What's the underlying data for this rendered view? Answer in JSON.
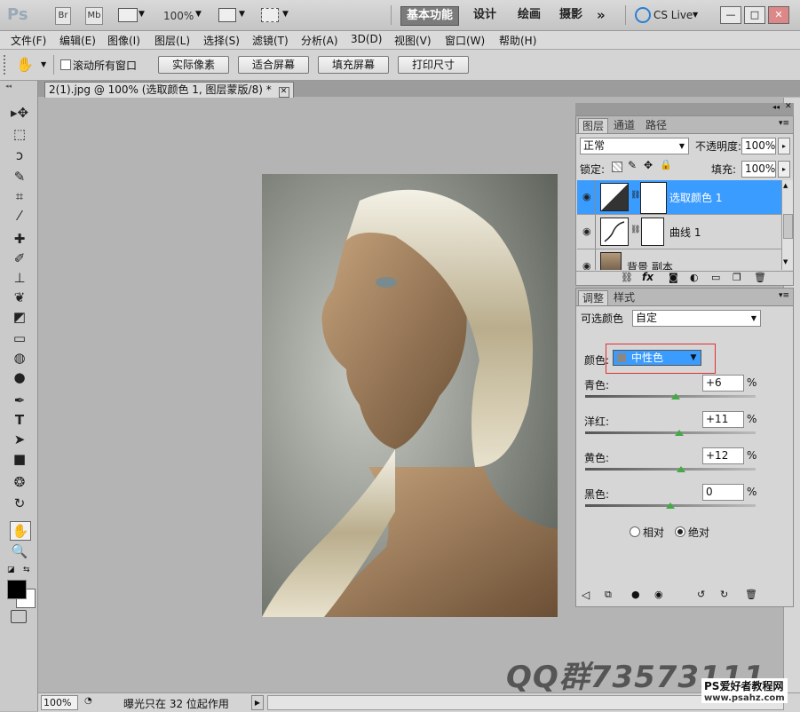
{
  "appbar": {
    "logo": "Ps",
    "br": "Br",
    "mb": "Mb",
    "zoom": "100%",
    "workspaces": [
      "基本功能",
      "设计",
      "绘画",
      "摄影"
    ],
    "more": "»",
    "cslive": "CS Live"
  },
  "menu": [
    "文件(F)",
    "编辑(E)",
    "图像(I)",
    "图层(L)",
    "选择(S)",
    "滤镜(T)",
    "分析(A)",
    "3D(D)",
    "视图(V)",
    "窗口(W)",
    "帮助(H)"
  ],
  "options": {
    "scroll_all": "滚动所有窗口",
    "buttons": [
      "实际像素",
      "适合屏幕",
      "填充屏幕",
      "打印尺寸"
    ]
  },
  "document": {
    "tab": "2(1).jpg @ 100% (选取颜色 1, 图层蒙版/8) *"
  },
  "status": {
    "zoom": "100%",
    "info": "曝光只在 32 位起作用"
  },
  "layers_panel": {
    "tabs": [
      "图层",
      "通道",
      "路径"
    ],
    "blend_mode": "正常",
    "opacity_label": "不透明度:",
    "opacity": "100%",
    "lock_label": "锁定:",
    "fill_label": "填充:",
    "fill": "100%",
    "layers": [
      {
        "name": "选取颜色 1",
        "selected": true
      },
      {
        "name": "曲线 1",
        "selected": false
      },
      {
        "name": "背景 副本",
        "selected": false
      }
    ],
    "fx": "fx"
  },
  "adjust_panel": {
    "tabs": [
      "调整",
      "样式"
    ],
    "title": "可选颜色",
    "preset": "自定",
    "color_label": "颜色:",
    "color_value": "中性色",
    "sliders": [
      {
        "label": "青色:",
        "value": "+6",
        "pos": 0.53
      },
      {
        "label": "洋红:",
        "value": "+11",
        "pos": 0.55
      },
      {
        "label": "黄色:",
        "value": "+12",
        "pos": 0.56
      },
      {
        "label": "黑色:",
        "value": "0",
        "pos": 0.5
      }
    ],
    "percent": "%",
    "method_relative": "相对",
    "method_absolute": "绝对",
    "method_selected": "绝对"
  },
  "watermark": {
    "qq": "QQ群73573111",
    "site_name": "PS爱好者教程网",
    "site_url": "www.psahz.com"
  },
  "colors": {
    "selection": "#3b9cff",
    "highlight_box": "#e03030"
  }
}
